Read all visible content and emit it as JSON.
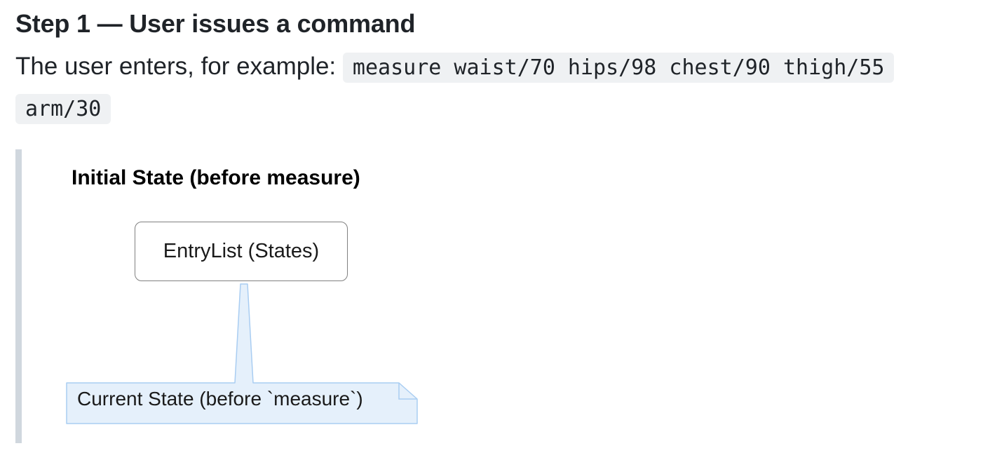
{
  "step": {
    "title": "Step 1 — User issues a command",
    "intro_text": "The user enters, for example: ",
    "command_example": "measure waist/70 hips/98 chest/90 thigh/55 arm/30"
  },
  "diagram": {
    "title": "Initial State (before measure)",
    "node_label": "EntryList (States)",
    "note_label": "Current State (before `measure`)",
    "colors": {
      "node_border": "#808080",
      "note_fill": "#e5f0fb",
      "note_border": "#a9cdf2",
      "quote_bar": "#d0d7de",
      "code_background": "#eff1f3"
    }
  }
}
